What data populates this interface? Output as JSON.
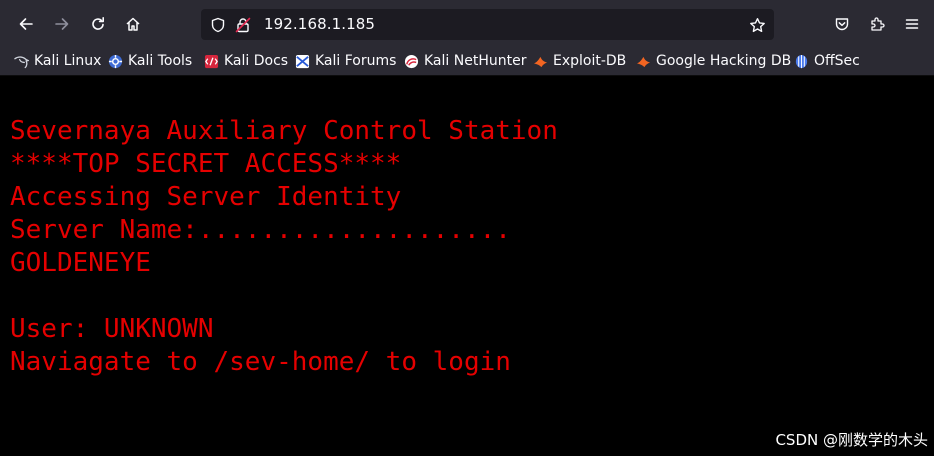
{
  "browser": {
    "url": "192.168.1.185",
    "bookmarks": [
      {
        "label": "Kali Linux",
        "icon": "kali-dragon-icon"
      },
      {
        "label": "Kali Tools",
        "icon": "kali-tools-icon"
      },
      {
        "label": "Kali Docs",
        "icon": "kali-docs-icon"
      },
      {
        "label": "Kali Forums",
        "icon": "kali-forums-icon"
      },
      {
        "label": "Kali NetHunter",
        "icon": "nethunter-icon"
      },
      {
        "label": "Exploit-DB",
        "icon": "exploit-db-icon"
      },
      {
        "label": "Google Hacking DB",
        "icon": "ghdb-icon"
      },
      {
        "label": "OffSec",
        "icon": "offsec-icon"
      }
    ],
    "colors": {
      "toolbar": "#2b2a33",
      "urlbar": "#1c1b22",
      "terminal_text": "#e50000",
      "page_background": "#000000"
    }
  },
  "page": {
    "lines": [
      "Severnaya Auxiliary Control Station",
      "****TOP SECRET ACCESS****",
      "Accessing Server Identity",
      "Server Name:....................",
      "GOLDENEYE",
      "",
      "User: UNKNOWN",
      "Naviagate to /sev-home/ to login"
    ]
  },
  "watermark": "CSDN @刚数学的木头"
}
